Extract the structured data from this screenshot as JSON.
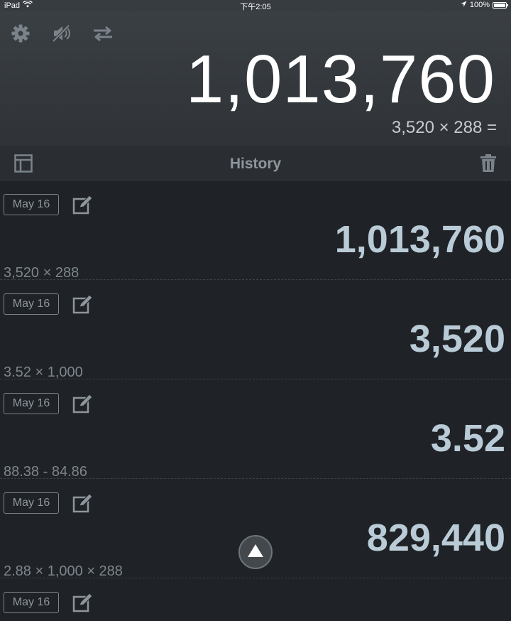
{
  "status_bar": {
    "device": "iPad",
    "time": "下午2:05",
    "battery": "100%"
  },
  "display": {
    "value": "1,013,760",
    "expression": "3,520 × 288 ="
  },
  "toolbar": {
    "icons": [
      "gear-icon",
      "speaker-muted-icon",
      "swap-arrows-icon"
    ]
  },
  "history": {
    "title": "History",
    "entries": [
      {
        "date": "May 16",
        "result": "1,013,760",
        "expression": "3,520 × 288"
      },
      {
        "date": "May 16",
        "result": "3,520",
        "expression": "3.52 × 1,000"
      },
      {
        "date": "May 16",
        "result": "3.52",
        "expression": "88.38 - 84.86"
      },
      {
        "date": "May 16",
        "result": "829,440",
        "expression": "2.88 × 1,000 × 288"
      },
      {
        "date": "May 16"
      }
    ]
  },
  "colors": {
    "display_bg": "#363b40",
    "list_bg": "#1f2226",
    "result_text": "#b9cbd6",
    "muted_text": "#8e969d"
  }
}
